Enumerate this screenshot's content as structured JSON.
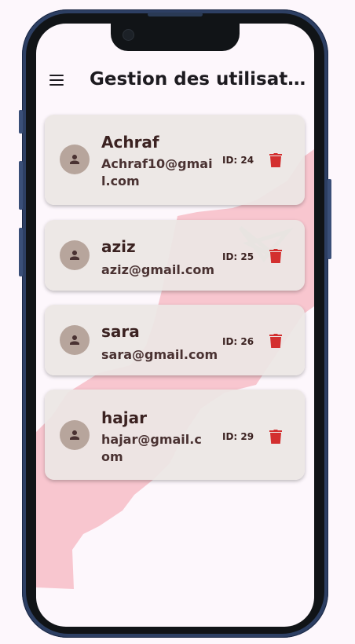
{
  "app_bar": {
    "menu_icon": "menu-icon",
    "title": "Gestion des utilisateurs"
  },
  "users": [
    {
      "name": "Achraf",
      "email": "Achraf10@gmail.com",
      "id_text": "ID: 24"
    },
    {
      "name": "aziz",
      "email": "aziz@gmail.com",
      "id_text": "ID: 25"
    },
    {
      "name": "sara",
      "email": "sara@gmail.com",
      "id_text": "ID: 26"
    },
    {
      "name": "hajar",
      "email": "hajar@gmail.com",
      "id_text": "ID: 29"
    }
  ],
  "icons": {
    "avatar": "person-icon",
    "delete": "trash-icon"
  },
  "colors": {
    "delete_red": "#d32f2f",
    "avatar_bg": "#b7a59c",
    "card_bg": "#ece6e4",
    "map_pink": "#f8c6cf",
    "phone_frame": "#2d3f63"
  }
}
